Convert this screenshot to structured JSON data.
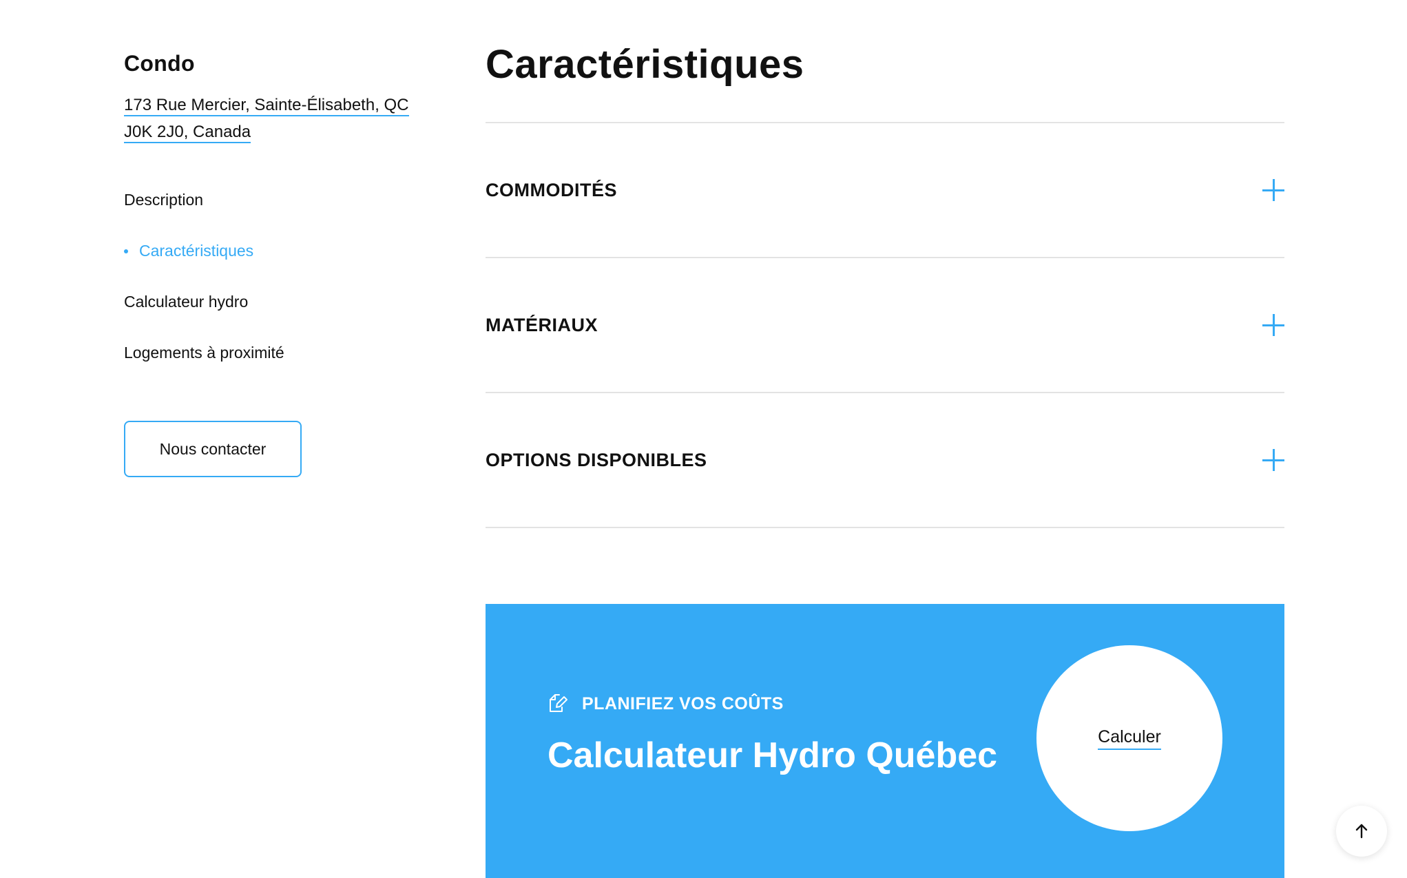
{
  "sidebar": {
    "property_type": "Condo",
    "address_line1": "173 Rue Mercier, Sainte-Élisabeth, QC",
    "address_line2": "J0K 2J0, Canada",
    "nav": [
      {
        "label": "Description",
        "active": false
      },
      {
        "label": "Caractéristiques",
        "active": true
      },
      {
        "label": "Calculateur hydro",
        "active": false
      },
      {
        "label": "Logements à proximité",
        "active": false
      }
    ],
    "contact_label": "Nous contacter"
  },
  "main": {
    "title": "Caractéristiques",
    "accordion": [
      {
        "label": "COMMODITÉS",
        "icon": "plus-icon"
      },
      {
        "label": "MATÉRIAUX",
        "icon": "plus-icon"
      },
      {
        "label": "OPTIONS DISPONIBLES",
        "icon": "plus-icon"
      }
    ]
  },
  "banner": {
    "eyebrow": "PLANIFIEZ VOS COÛTS",
    "eyebrow_icon": "pencil-edit-icon",
    "title": "Calculateur Hydro Québec",
    "cta": "Calculer",
    "background": "#35aaf5"
  },
  "scroll_top": {
    "icon": "arrow-up-icon"
  },
  "colors": {
    "accent": "#35aaf5",
    "text": "#111111",
    "divider": "#e3e3e3"
  }
}
